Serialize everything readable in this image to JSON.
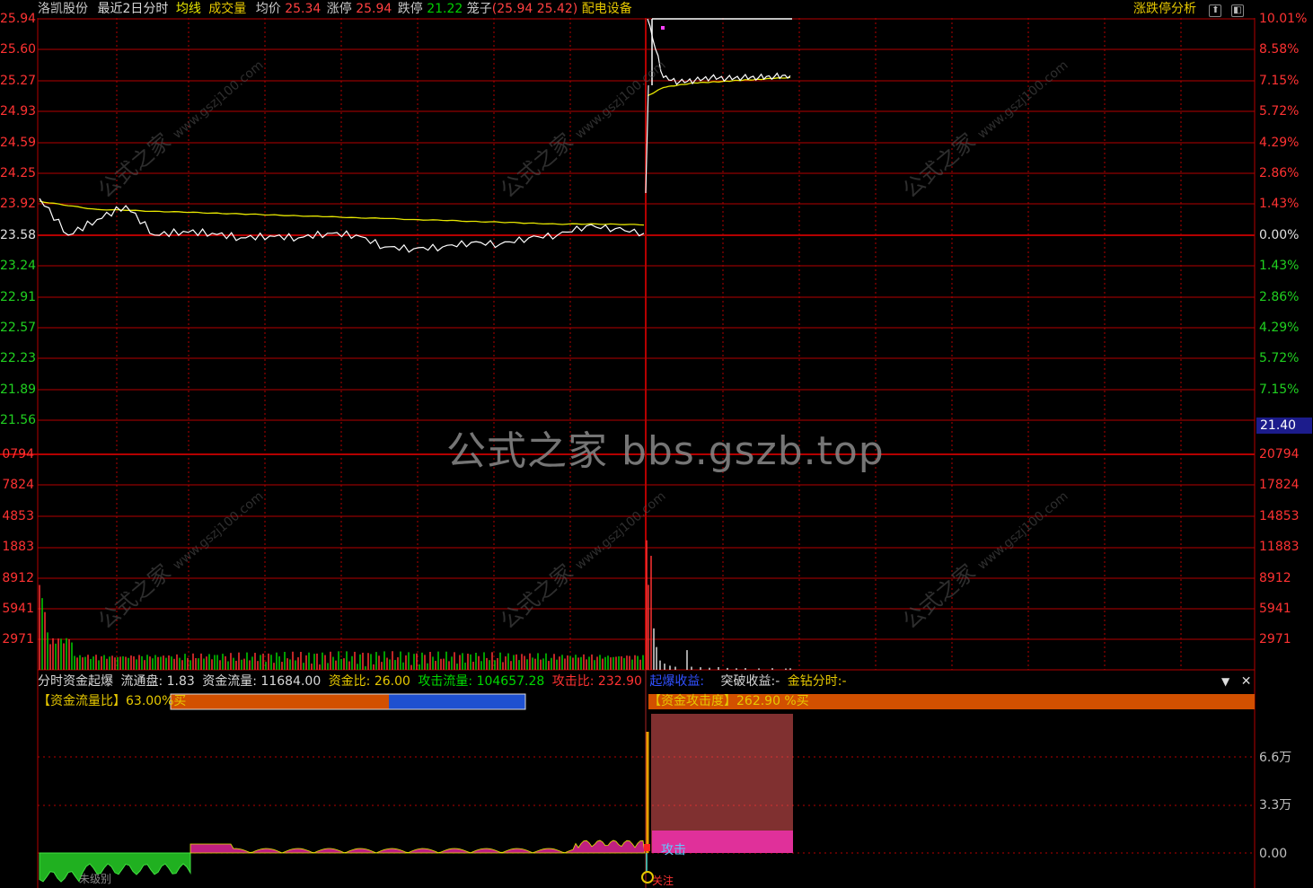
{
  "header": {
    "stock_name": "洛凯股份",
    "period": "最近2日分时",
    "avg_line_label": "均线",
    "volume_label": "成交量",
    "avg_price_label": "均价",
    "avg_price_value": "25.34",
    "limit_up_label": "涨停",
    "limit_up_value": "25.94",
    "limit_down_label": "跌停",
    "limit_down_value": "21.22",
    "cage_label": "笼子",
    "cage_value": "(25.94 25.42)",
    "sector": "配电设备",
    "analysis_link": "涨跌停分析",
    "icons": [
      "restore-icon",
      "window-icon"
    ]
  },
  "price_axis": {
    "left": [
      "25.94",
      "25.60",
      "25.27",
      "24.93",
      "24.59",
      "24.25",
      "23.92",
      "23.58",
      "23.24",
      "22.91",
      "22.57",
      "22.23",
      "21.89",
      "21.56"
    ],
    "right": [
      "10.01%",
      "8.58%",
      "7.15%",
      "5.72%",
      "4.29%",
      "2.86%",
      "1.43%",
      "0.00%",
      "1.43%",
      "2.86%",
      "4.29%",
      "5.72%",
      "7.15%"
    ],
    "cursor_value": "21.40"
  },
  "volume_axis": {
    "left": [
      "0794",
      "7824",
      "4853",
      "1883",
      "8912",
      "5941",
      "2971"
    ],
    "right": [
      "20794",
      "17824",
      "14853",
      "11883",
      "8912",
      "5941",
      "2971"
    ]
  },
  "indicator": {
    "name": "分时资金起爆",
    "float_label": "流通盘:",
    "float_value": "1.83",
    "flow_label": "资金流量:",
    "flow_value": "11684.00",
    "ratio_label": "资金比:",
    "ratio_value": "26.00",
    "attack_flow_label": "攻击流量:",
    "attack_flow_value": "104657.28",
    "attack_ratio_label": "攻击比:",
    "attack_ratio_value": "232.90",
    "burst_label": "起爆收益:",
    "breakout_label": "突破收益:",
    "breakout_value": "-",
    "diamond_label": "金钻分时:",
    "diamond_value": "-",
    "flow_ratio_box": "【资金流量比】63.00%买",
    "attack_box": "【资金攻击度】262.90 %买",
    "attack_marker": "攻击",
    "follow_marker": "关注",
    "left_bottom_label": "未级别",
    "axis": [
      "6.6万",
      "3.3万",
      "0.00"
    ],
    "controls": [
      "dropdown-icon",
      "close-icon"
    ]
  },
  "watermark": {
    "center": "公式之家 bbs.gszb.top",
    "tiles": [
      "公式之家",
      "www.gszj100.com"
    ]
  },
  "colors": {
    "grid": "#b40000",
    "price_line": "#ffffff",
    "avg_line": "#e6e600",
    "up": "#ff3232",
    "down": "#00d000",
    "header_yellow": "#e6c800",
    "blue_bar": "#1e50d0",
    "orange_bar": "#d25000"
  },
  "chart_data": {
    "type": "line",
    "series": [
      {
        "name": "均线",
        "values": [
          23.95,
          23.9,
          23.86,
          23.85,
          23.84,
          23.83,
          23.82,
          23.81,
          23.8,
          23.79,
          23.78,
          23.77,
          23.76,
          23.75,
          23.74,
          23.73,
          23.72,
          23.71,
          23.7,
          23.7,
          23.7,
          23.69,
          25.1,
          25.19,
          25.22,
          25.24,
          25.25,
          25.26,
          25.27,
          25.28,
          25.29,
          25.3
        ]
      },
      {
        "name": "价格",
        "values": [
          23.98,
          23.58,
          23.75,
          23.9,
          23.58,
          23.62,
          23.6,
          23.55,
          23.57,
          23.55,
          23.6,
          23.58,
          23.45,
          23.43,
          23.45,
          23.5,
          23.48,
          23.55,
          23.58,
          23.68,
          23.65,
          23.6,
          25.94,
          25.3,
          25.25,
          25.27,
          25.3,
          25.29,
          25.3,
          25.3,
          25.31,
          25.32
        ]
      }
    ],
    "ylim": [
      21.22,
      25.94
    ],
    "volume_ylim": [
      0,
      20794
    ]
  }
}
